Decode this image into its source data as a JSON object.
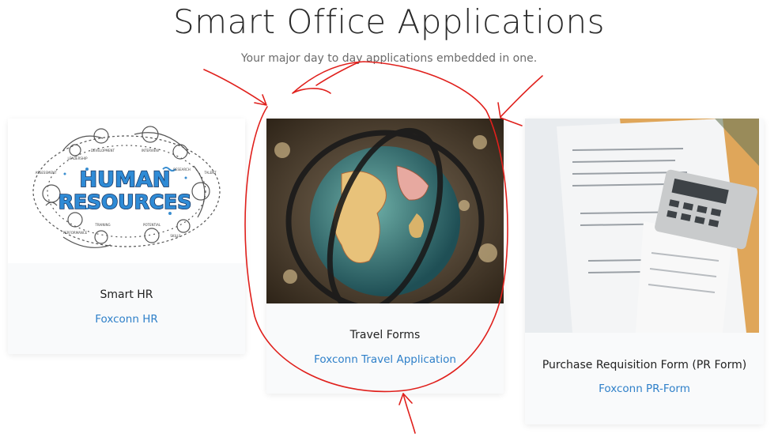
{
  "header": {
    "title": "Smart Office Applications",
    "subtitle": "Your major day to day applications embedded in one."
  },
  "cards": [
    {
      "title": "Smart HR",
      "link": "Foxconn HR",
      "image_logo_text": [
        "HUMAN",
        "RESOURCES"
      ],
      "image_ring_labels": [
        "LEADERSHIP",
        "DEVELOPMENT",
        "INTERVIEW",
        "RESEARCH",
        "TALENT",
        "SKILLS",
        "POTENTIAL",
        "TRAINING",
        "PERFORMANCE",
        "ASSESSMENT"
      ]
    },
    {
      "title": "Travel Forms",
      "link": "Foxconn Travel Application"
    },
    {
      "title": "Purchase Requisition Form (PR Form)",
      "link": "Foxconn PR-Form"
    }
  ],
  "colors": {
    "link": "#2f80c9",
    "annotation": "#e0201c",
    "card_bg": "#f9fafb"
  }
}
